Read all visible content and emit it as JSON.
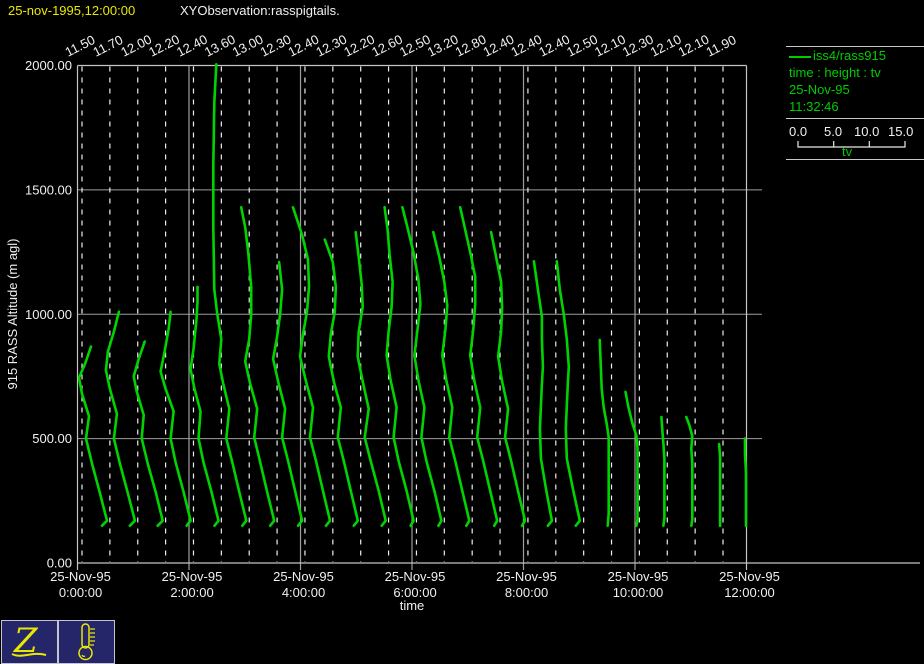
{
  "header": {
    "timestamp": "25-nov-1995,12:00:00",
    "title": "XYObservation:rasspigtails."
  },
  "legend": {
    "series_label": "iss4/rass915",
    "fields_label": "time : height : tv",
    "date": "25-Nov-95",
    "time": "11:32:46",
    "scale_ticks": [
      "0.0",
      "5.0",
      "10.0",
      "15.0"
    ],
    "scale_label": "tv"
  },
  "toolbar": {
    "zebra_glyph": "Z",
    "thermometer_icon": "thermometer"
  },
  "colors": {
    "background": "#000000",
    "curve_green": "#00d400",
    "legend_green": "#00cc00",
    "accent_yellow": "#e8e800",
    "text_white": "#f0f0f0",
    "grid_gray": "#9e9e9e",
    "frame_gray": "#c4c4c4",
    "icon_bg_navy": "#252569"
  },
  "chart_data": {
    "type": "line",
    "title": "",
    "xlabel": "time",
    "ylabel": "915 RASS Altitude (m agl)",
    "ylim": [
      0,
      2000
    ],
    "y_ticks": [
      "2000.00",
      "1500.00",
      "1000.00",
      "500.00",
      "0.00"
    ],
    "x_ticks": [
      {
        "date": "25-Nov-95",
        "time": "0:00:00"
      },
      {
        "date": "25-Nov-95",
        "time": "2:00:00"
      },
      {
        "date": "25-Nov-95",
        "time": "4:00:00"
      },
      {
        "date": "25-Nov-95",
        "time": "6:00:00"
      },
      {
        "date": "25-Nov-95",
        "time": "8:00:00"
      },
      {
        "date": "25-Nov-95",
        "time": "10:00:00"
      },
      {
        "date": "25-Nov-95",
        "time": "12:00:00"
      }
    ],
    "grid": true,
    "legend_position": "top-right",
    "top_tv_labels": [
      "11.50",
      "11.70",
      "12.00",
      "12.20",
      "12.40",
      "13.60",
      "13.00",
      "12.30",
      "12.40",
      "12.30",
      "12.20",
      "12.60",
      "12.50",
      "13.20",
      "12.80",
      "12.40",
      "12.40",
      "12.40",
      "12.50",
      "12.10",
      "12.30",
      "12.10",
      "12.10",
      "11.90"
    ],
    "profiles": [
      {
        "tv_top": "11.50",
        "points": [
          [
            150,
            20
          ],
          [
            170,
            25
          ],
          [
            280,
            18
          ],
          [
            400,
            10
          ],
          [
            500,
            4
          ],
          [
            590,
            7
          ],
          [
            680,
            0
          ],
          [
            745,
            -3
          ],
          [
            800,
            3
          ],
          [
            870,
            9
          ]
        ]
      },
      {
        "tv_top": "11.70",
        "points": [
          [
            150,
            20
          ],
          [
            170,
            25
          ],
          [
            280,
            18
          ],
          [
            400,
            10
          ],
          [
            500,
            4
          ],
          [
            600,
            7
          ],
          [
            700,
            0
          ],
          [
            775,
            -4
          ],
          [
            850,
            -2
          ],
          [
            930,
            4
          ],
          [
            1010,
            9
          ]
        ]
      },
      {
        "tv_top": "12.00",
        "points": [
          [
            150,
            20
          ],
          [
            170,
            25
          ],
          [
            285,
            18
          ],
          [
            400,
            10
          ],
          [
            500,
            4
          ],
          [
            595,
            6
          ],
          [
            690,
            -1
          ],
          [
            750,
            -4
          ],
          [
            820,
            1
          ],
          [
            890,
            7
          ]
        ]
      },
      {
        "tv_top": "12.20",
        "points": [
          [
            150,
            21
          ],
          [
            170,
            25
          ],
          [
            285,
            18
          ],
          [
            405,
            10
          ],
          [
            500,
            5
          ],
          [
            610,
            8
          ],
          [
            700,
            0
          ],
          [
            770,
            -5
          ],
          [
            850,
            -1
          ],
          [
            940,
            3
          ],
          [
            1010,
            5
          ]
        ]
      },
      {
        "tv_top": "12.40",
        "points": [
          [
            150,
            21
          ],
          [
            170,
            25
          ],
          [
            285,
            18
          ],
          [
            405,
            10
          ],
          [
            500,
            5
          ],
          [
            610,
            7
          ],
          [
            700,
            1
          ],
          [
            780,
            -3
          ],
          [
            860,
            0
          ],
          [
            980,
            3
          ],
          [
            1050,
            4
          ],
          [
            1110,
            4
          ]
        ]
      },
      {
        "tv_top": "13.60",
        "points": [
          [
            150,
            21
          ],
          [
            170,
            25
          ],
          [
            285,
            18
          ],
          [
            405,
            11
          ],
          [
            500,
            5
          ],
          [
            620,
            8
          ],
          [
            720,
            2
          ],
          [
            800,
            -2
          ],
          [
            900,
            0
          ],
          [
            1000,
            -4
          ],
          [
            1100,
            -7
          ],
          [
            1350,
            -8
          ],
          [
            1600,
            -8
          ],
          [
            1850,
            -7
          ],
          [
            2005,
            -5
          ]
        ]
      },
      {
        "tv_top": "13.00",
        "points": [
          [
            150,
            21
          ],
          [
            170,
            25
          ],
          [
            285,
            18
          ],
          [
            405,
            11
          ],
          [
            505,
            5
          ],
          [
            620,
            8
          ],
          [
            720,
            1
          ],
          [
            810,
            -4
          ],
          [
            900,
            0
          ],
          [
            1000,
            2
          ],
          [
            1110,
            2
          ],
          [
            1250,
            -1
          ],
          [
            1350,
            -4
          ],
          [
            1430,
            -8
          ]
        ]
      },
      {
        "tv_top": "12.30",
        "points": [
          [
            150,
            21
          ],
          [
            170,
            25
          ],
          [
            290,
            18
          ],
          [
            410,
            11
          ],
          [
            505,
            5
          ],
          [
            620,
            8
          ],
          [
            730,
            1
          ],
          [
            820,
            -4
          ],
          [
            910,
            0
          ],
          [
            1000,
            3
          ],
          [
            1100,
            5
          ],
          [
            1210,
            2
          ]
        ]
      },
      {
        "tv_top": "12.40",
        "points": [
          [
            150,
            21
          ],
          [
            170,
            25
          ],
          [
            290,
            18
          ],
          [
            410,
            11
          ],
          [
            505,
            5
          ],
          [
            625,
            8
          ],
          [
            730,
            1
          ],
          [
            830,
            -5
          ],
          [
            920,
            -2
          ],
          [
            1010,
            2
          ],
          [
            1110,
            4
          ],
          [
            1220,
            3
          ],
          [
            1320,
            -3
          ],
          [
            1430,
            -12
          ]
        ]
      },
      {
        "tv_top": "12.30",
        "points": [
          [
            150,
            21
          ],
          [
            170,
            25
          ],
          [
            290,
            18
          ],
          [
            410,
            11
          ],
          [
            505,
            5
          ],
          [
            625,
            8
          ],
          [
            730,
            1
          ],
          [
            830,
            -4
          ],
          [
            920,
            -2
          ],
          [
            1010,
            2
          ],
          [
            1110,
            3
          ],
          [
            1210,
            0
          ],
          [
            1300,
            -8
          ]
        ]
      },
      {
        "tv_top": "12.20",
        "points": [
          [
            150,
            21
          ],
          [
            170,
            25
          ],
          [
            290,
            18
          ],
          [
            410,
            10
          ],
          [
            505,
            4
          ],
          [
            620,
            8
          ],
          [
            730,
            2
          ],
          [
            830,
            -3
          ],
          [
            930,
            -2
          ],
          [
            1030,
            2
          ],
          [
            1120,
            1
          ],
          [
            1230,
            -2
          ],
          [
            1330,
            -5
          ]
        ]
      },
      {
        "tv_top": "12.60",
        "points": [
          [
            150,
            22
          ],
          [
            170,
            25
          ],
          [
            290,
            18
          ],
          [
            410,
            10
          ],
          [
            505,
            5
          ],
          [
            625,
            8
          ],
          [
            735,
            2
          ],
          [
            835,
            -2
          ],
          [
            930,
            0
          ],
          [
            1030,
            3
          ],
          [
            1130,
            4
          ],
          [
            1240,
            1
          ],
          [
            1340,
            -1
          ],
          [
            1430,
            -4
          ]
        ]
      },
      {
        "tv_top": "12.50",
        "points": [
          [
            150,
            22
          ],
          [
            170,
            25
          ],
          [
            290,
            18
          ],
          [
            410,
            10
          ],
          [
            505,
            5
          ],
          [
            625,
            8
          ],
          [
            735,
            2
          ],
          [
            835,
            -2
          ],
          [
            935,
            1
          ],
          [
            1040,
            4
          ],
          [
            1140,
            2
          ],
          [
            1250,
            -3
          ],
          [
            1350,
            -9
          ],
          [
            1430,
            -14
          ]
        ]
      },
      {
        "tv_top": "13.20",
        "points": [
          [
            150,
            22
          ],
          [
            170,
            25
          ],
          [
            290,
            18
          ],
          [
            410,
            11
          ],
          [
            505,
            5
          ],
          [
            625,
            8
          ],
          [
            735,
            2
          ],
          [
            835,
            -2
          ],
          [
            935,
            1
          ],
          [
            1035,
            3
          ],
          [
            1130,
            0
          ],
          [
            1230,
            -5
          ],
          [
            1330,
            -11
          ]
        ]
      },
      {
        "tv_top": "12.80",
        "points": [
          [
            150,
            22
          ],
          [
            170,
            25
          ],
          [
            290,
            18
          ],
          [
            410,
            11
          ],
          [
            505,
            5
          ],
          [
            625,
            8
          ],
          [
            735,
            2
          ],
          [
            835,
            -2
          ],
          [
            935,
            1
          ],
          [
            1040,
            3
          ],
          [
            1150,
            3
          ],
          [
            1250,
            -2
          ],
          [
            1340,
            -7
          ],
          [
            1430,
            -12
          ]
        ]
      },
      {
        "tv_top": "12.40",
        "points": [
          [
            150,
            22
          ],
          [
            170,
            25
          ],
          [
            290,
            18
          ],
          [
            410,
            11
          ],
          [
            505,
            5
          ],
          [
            620,
            8
          ],
          [
            730,
            2
          ],
          [
            830,
            -2
          ],
          [
            930,
            1
          ],
          [
            1030,
            2
          ],
          [
            1130,
            1
          ],
          [
            1230,
            -4
          ],
          [
            1330,
            -9
          ]
        ]
      },
      {
        "tv_top": "12.40",
        "points": [
          [
            150,
            20
          ],
          [
            170,
            24
          ],
          [
            300,
            18
          ],
          [
            420,
            13
          ],
          [
            540,
            12
          ],
          [
            630,
            13
          ],
          [
            720,
            14
          ],
          [
            790,
            15
          ],
          [
            900,
            14
          ],
          [
            990,
            14
          ],
          [
            1100,
            10
          ],
          [
            1213,
            6
          ]
        ]
      },
      {
        "tv_top": "12.40",
        "points": [
          [
            150,
            20
          ],
          [
            170,
            24
          ],
          [
            300,
            17
          ],
          [
            420,
            11
          ],
          [
            540,
            10
          ],
          [
            630,
            11
          ],
          [
            720,
            12
          ],
          [
            790,
            13
          ],
          [
            900,
            11
          ],
          [
            1000,
            8
          ],
          [
            1100,
            4
          ],
          [
            1213,
            1
          ]
        ]
      },
      {
        "tv_top": "12.50",
        "points": [
          [
            150,
            24
          ],
          [
            200,
            25
          ],
          [
            420,
            25
          ],
          [
            505,
            25
          ],
          [
            560,
            23
          ],
          [
            625,
            20
          ],
          [
            700,
            18
          ],
          [
            800,
            17
          ],
          [
            897,
            16
          ]
        ]
      },
      {
        "tv_top": "12.10",
        "points": [
          [
            150,
            25
          ],
          [
            175,
            26
          ],
          [
            350,
            26
          ],
          [
            460,
            26
          ],
          [
            510,
            25
          ],
          [
            560,
            21
          ],
          [
            625,
            17
          ],
          [
            688,
            14
          ]
        ]
      },
      {
        "tv_top": "12.30",
        "points": [
          [
            150,
            24
          ],
          [
            180,
            25
          ],
          [
            300,
            25
          ],
          [
            420,
            25
          ],
          [
            480,
            24
          ],
          [
            530,
            23
          ],
          [
            587,
            22
          ]
        ]
      },
      {
        "tv_top": "12.10",
        "points": [
          [
            150,
            24
          ],
          [
            175,
            25
          ],
          [
            290,
            25
          ],
          [
            400,
            25
          ],
          [
            460,
            24
          ],
          [
            510,
            25
          ],
          [
            555,
            22
          ],
          [
            587,
            19
          ]
        ]
      },
      {
        "tv_top": "12.10",
        "points": [
          [
            150,
            25
          ],
          [
            260,
            25
          ],
          [
            370,
            25
          ],
          [
            430,
            25
          ],
          [
            478,
            24
          ]
        ]
      },
      {
        "tv_top": "11.90",
        "points": [
          [
            150,
            23
          ],
          [
            260,
            23
          ],
          [
            360,
            23
          ],
          [
            440,
            22
          ],
          [
            500,
            22
          ]
        ]
      }
    ]
  }
}
